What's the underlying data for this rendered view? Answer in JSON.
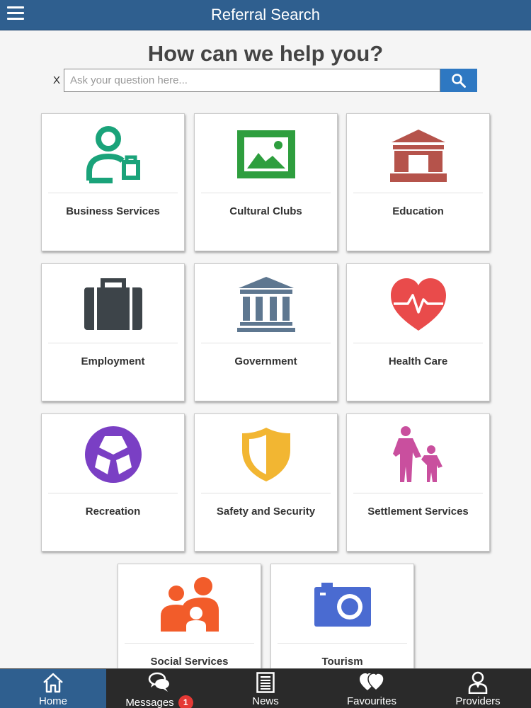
{
  "header": {
    "title": "Referral Search"
  },
  "search": {
    "heading": "How can we help you?",
    "clear_label": "X",
    "placeholder": "Ask your question here..."
  },
  "tiles": [
    {
      "label": "Business Services",
      "icon": "business-person-icon",
      "color": "#1aa37a"
    },
    {
      "label": "Cultural Clubs",
      "icon": "picture-frame-icon",
      "color": "#2e9e3e"
    },
    {
      "label": "Education",
      "icon": "school-building-icon",
      "color": "#b5534b"
    },
    {
      "label": "Employment",
      "icon": "briefcase-icon",
      "color": "#3d4449"
    },
    {
      "label": "Government",
      "icon": "government-building-icon",
      "color": "#5e7790"
    },
    {
      "label": "Health Care",
      "icon": "heart-pulse-icon",
      "color": "#e94b4b"
    },
    {
      "label": "Recreation",
      "icon": "soccer-ball-icon",
      "color": "#7a3fc4"
    },
    {
      "label": "Safety and Security",
      "icon": "shield-icon",
      "color": "#f2b632"
    },
    {
      "label": "Settlement Services",
      "icon": "parent-child-icon",
      "color": "#c94f9e"
    },
    {
      "label": "Social Services",
      "icon": "people-group-icon",
      "color": "#f25c2a"
    },
    {
      "label": "Tourism",
      "icon": "camera-icon",
      "color": "#4a6bd1"
    }
  ],
  "tabbar": {
    "tabs": [
      {
        "label": "Home",
        "icon": "home-icon",
        "active": true
      },
      {
        "label": "Messages",
        "icon": "chat-bubbles-icon",
        "badge": "1"
      },
      {
        "label": "News",
        "icon": "newspaper-icon"
      },
      {
        "label": "Favourites",
        "icon": "hearts-icon"
      },
      {
        "label": "Providers",
        "icon": "provider-person-icon"
      }
    ]
  }
}
